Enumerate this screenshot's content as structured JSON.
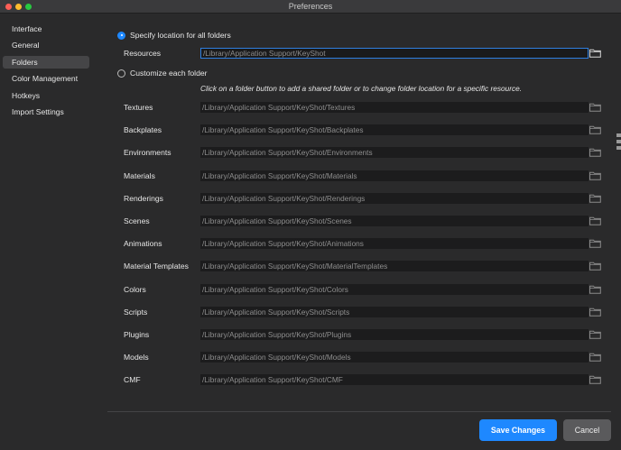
{
  "window": {
    "title": "Preferences"
  },
  "sidebar": {
    "items": [
      {
        "label": "Interface",
        "active": false
      },
      {
        "label": "General",
        "active": false
      },
      {
        "label": "Folders",
        "active": true
      },
      {
        "label": "Color Management",
        "active": false
      },
      {
        "label": "Hotkeys",
        "active": false
      },
      {
        "label": "Import Settings",
        "active": false
      }
    ]
  },
  "folders": {
    "specify_all_label": "Specify location for all folders",
    "resources_label": "Resources",
    "resources_path": "/Library/Application Support/KeyShot",
    "customize_label": "Customize each folder",
    "hint": "Click on a folder button to add a shared folder or to change folder location for a specific resource.",
    "rows": [
      {
        "label": "Textures",
        "path": "/Library/Application Support/KeyShot/Textures"
      },
      {
        "label": "Backplates",
        "path": "/Library/Application Support/KeyShot/Backplates"
      },
      {
        "label": "Environments",
        "path": "/Library/Application Support/KeyShot/Environments"
      },
      {
        "label": "Materials",
        "path": "/Library/Application Support/KeyShot/Materials"
      },
      {
        "label": "Renderings",
        "path": "/Library/Application Support/KeyShot/Renderings"
      },
      {
        "label": "Scenes",
        "path": "/Library/Application Support/KeyShot/Scenes"
      },
      {
        "label": "Animations",
        "path": "/Library/Application Support/KeyShot/Animations"
      },
      {
        "label": "Material Templates",
        "path": "/Library/Application Support/KeyShot/MaterialTemplates"
      },
      {
        "label": "Colors",
        "path": "/Library/Application Support/KeyShot/Colors"
      },
      {
        "label": "Scripts",
        "path": "/Library/Application Support/KeyShot/Scripts"
      },
      {
        "label": "Plugins",
        "path": "/Library/Application Support/KeyShot/Plugins"
      },
      {
        "label": "Models",
        "path": "/Library/Application Support/KeyShot/Models"
      },
      {
        "label": "CMF",
        "path": "/Library/Application Support/KeyShot/CMF"
      }
    ]
  },
  "footer": {
    "save_label": "Save Changes",
    "cancel_label": "Cancel"
  },
  "colors": {
    "accent": "#1e88ff",
    "background": "#2a2a2b",
    "field": "#1c1c1d"
  }
}
